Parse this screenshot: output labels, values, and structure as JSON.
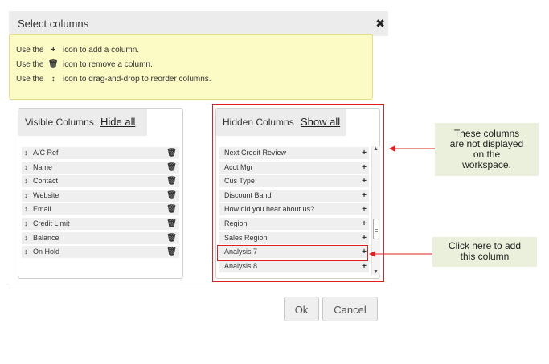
{
  "dialog": {
    "title": "Select columns",
    "close_glyph": "✖"
  },
  "info": {
    "lines": [
      {
        "pre": "Use the",
        "icon": "plus-icon",
        "glyph": "+",
        "post": "icon to add a column."
      },
      {
        "pre": "Use the",
        "icon": "trash-icon",
        "glyph": "🗑",
        "post": "icon to remove a column."
      },
      {
        "pre": "Use the",
        "icon": "drag-arrows-icon",
        "glyph": "↕",
        "post": "icon to drag-and-drop to reorder columns."
      }
    ]
  },
  "visible_panel": {
    "title": "Visible Columns",
    "action": "Hide all",
    "items": [
      "A/C Ref",
      "Name",
      "Contact",
      "Website",
      "Email",
      "Credit Limit",
      "Balance",
      "On Hold"
    ]
  },
  "hidden_panel": {
    "title": "Hidden Columns",
    "action": "Show all",
    "items": [
      "Next Credit Review",
      "Acct Mgr",
      "Cus Type",
      "Discount Band",
      "How did you hear about us?",
      "Region",
      "Sales Region",
      "Analysis 7",
      "Analysis 8"
    ]
  },
  "icons": {
    "drag": "↕",
    "trash": "🗑",
    "plus": "+",
    "scroll_up": "▲",
    "scroll_down": "▼"
  },
  "callouts": {
    "hidden_note": [
      "These columns",
      "are not displayed",
      "on the",
      "workspace."
    ],
    "add_note": [
      "Click here to add",
      "this column"
    ]
  },
  "buttons": {
    "ok": "Ok",
    "cancel": "Cancel"
  },
  "colors": {
    "annotation_red": "#e02020",
    "info_bg": "#fdfbc5",
    "callout_bg": "#ebf0dc"
  }
}
